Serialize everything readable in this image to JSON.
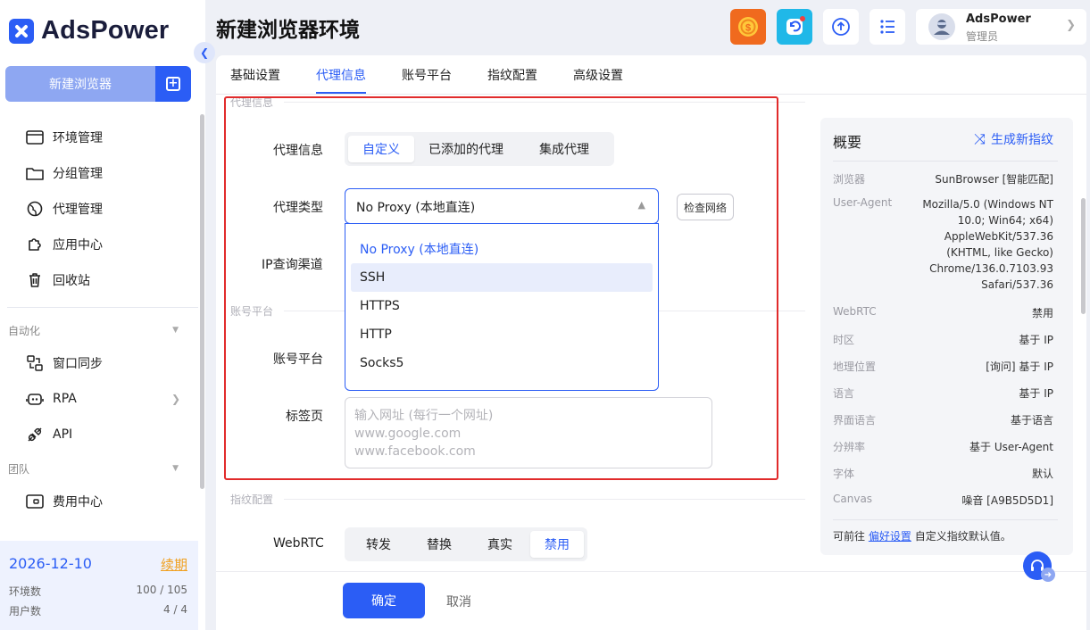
{
  "app": {
    "name": "AdsPower"
  },
  "sidebar": {
    "new_browser_label": "新建浏览器",
    "main_items": [
      {
        "label": "环境管理",
        "icon": "browser-window-icon"
      },
      {
        "label": "分组管理",
        "icon": "folder-icon"
      },
      {
        "label": "代理管理",
        "icon": "globe-icon"
      },
      {
        "label": "应用中心",
        "icon": "puzzle-icon"
      },
      {
        "label": "回收站",
        "icon": "trash-icon"
      }
    ],
    "automation_title": "自动化",
    "automation_items": [
      {
        "label": "窗口同步",
        "icon": "sync-windows-icon"
      },
      {
        "label": "RPA",
        "icon": "robot-icon"
      },
      {
        "label": "API",
        "icon": "plug-icon"
      }
    ],
    "team_title": "团队",
    "team_items": [
      {
        "label": "费用中心",
        "icon": "wallet-icon"
      }
    ],
    "plan": {
      "expiry": "2026-12-10",
      "renew_label": "续期",
      "env_label": "环境数",
      "env_value": "100 / 105",
      "user_label": "用户数",
      "user_value": "4 / 4"
    }
  },
  "header": {
    "title": "新建浏览器环境",
    "user_name": "AdsPower",
    "user_role": "管理员"
  },
  "tabs": [
    "基础设置",
    "代理信息",
    "账号平台",
    "指纹配置",
    "高级设置"
  ],
  "proxy": {
    "group_title": "代理信息",
    "info_label": "代理信息",
    "info_options": [
      "自定义",
      "已添加的代理",
      "集成代理"
    ],
    "type_label": "代理类型",
    "type_value": "No Proxy (本地直连)",
    "check_network_label": "检查网络",
    "ip_channel_label": "IP查询渠道",
    "type_options": [
      "No Proxy (本地直连)",
      "SSH",
      "HTTPS",
      "HTTP",
      "Socks5"
    ]
  },
  "account": {
    "group_title": "账号平台",
    "platform_label": "账号平台",
    "tabs_label": "标签页",
    "tabs_placeholder_lines": [
      "输入网址 (每行一个网址)",
      "www.google.com",
      "www.facebook.com"
    ]
  },
  "fingerprint": {
    "group_title": "指纹配置",
    "webrtc_label": "WebRTC",
    "webrtc_options": [
      "转发",
      "替换",
      "真实",
      "禁用"
    ]
  },
  "overview": {
    "title": "概要",
    "generate_label": "生成新指纹",
    "rows": [
      {
        "key": "浏览器",
        "value": "SunBrowser [智能匹配]"
      },
      {
        "key": "User-Agent",
        "value": "Mozilla/5.0 (Windows NT 10.0; Win64; x64) AppleWebKit/537.36 (KHTML, like Gecko) Chrome/136.0.7103.93 Safari/537.36"
      },
      {
        "key": "WebRTC",
        "value": "禁用"
      },
      {
        "key": "时区",
        "value": "基于 IP"
      },
      {
        "key": "地理位置",
        "value": "[询问] 基于 IP"
      },
      {
        "key": "语言",
        "value": "基于 IP"
      },
      {
        "key": "界面语言",
        "value": "基于语言"
      },
      {
        "key": "分辨率",
        "value": "基于 User-Agent"
      },
      {
        "key": "字体",
        "value": "默认"
      },
      {
        "key": "Canvas",
        "value": "噪音 [A9B5D5D1]"
      }
    ],
    "foot_prefix": "可前往",
    "foot_link": "偏好设置",
    "foot_suffix": "自定义指纹默认值。"
  },
  "footer": {
    "ok_label": "确定",
    "cancel_label": "取消"
  },
  "colors": {
    "accent": "#2b5df5",
    "highlight_border": "#e12b2b",
    "renew": "#f0a020"
  }
}
